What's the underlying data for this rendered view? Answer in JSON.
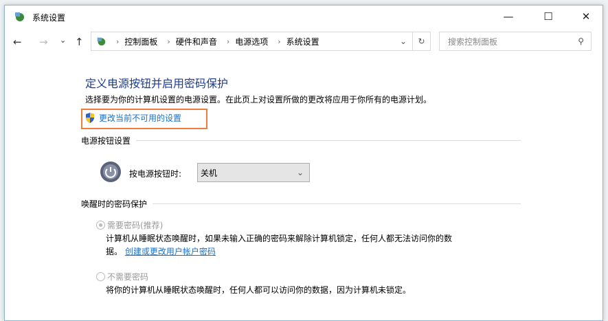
{
  "window": {
    "title": "系统设置",
    "minimize": "—",
    "maximize": "☐",
    "close": "✕"
  },
  "nav": {
    "back": "←",
    "forward": "→",
    "recent": "⌄",
    "up": "↑"
  },
  "address": {
    "breadcrumbs": [
      "控制面板",
      "硬件和声音",
      "电源选项",
      "系统设置"
    ],
    "dropdown": "⌄",
    "refresh": "↻"
  },
  "search": {
    "placeholder": "搜索控制面板",
    "icon": "⚲"
  },
  "main": {
    "heading": "定义电源按钮并启用密码保护",
    "description": "选择要为你的计算机设置的电源设置。在此页上对设置所做的更改将应用于你所有的电源计划。",
    "change_link": "更改当前不可用的设置",
    "power_section": {
      "title": "电源按钮设置",
      "label": "按电源按钮时:",
      "value": "关机"
    },
    "password_section": {
      "title": "唤醒时的密码保护",
      "options": [
        {
          "label": "需要密码(推荐)",
          "selected": true,
          "desc": "计算机从睡眠状态唤醒时，如果未输入正确的密码来解除计算机锁定，任何人都无法访问你的数",
          "desc2": "据。",
          "link": "创建或更改用户帐户密码"
        },
        {
          "label": "不需要密码",
          "selected": false,
          "desc": "将你的计算机从睡眠状态唤醒时，任何人都可以访问你的数据，因为计算机未锁定。"
        }
      ]
    }
  }
}
